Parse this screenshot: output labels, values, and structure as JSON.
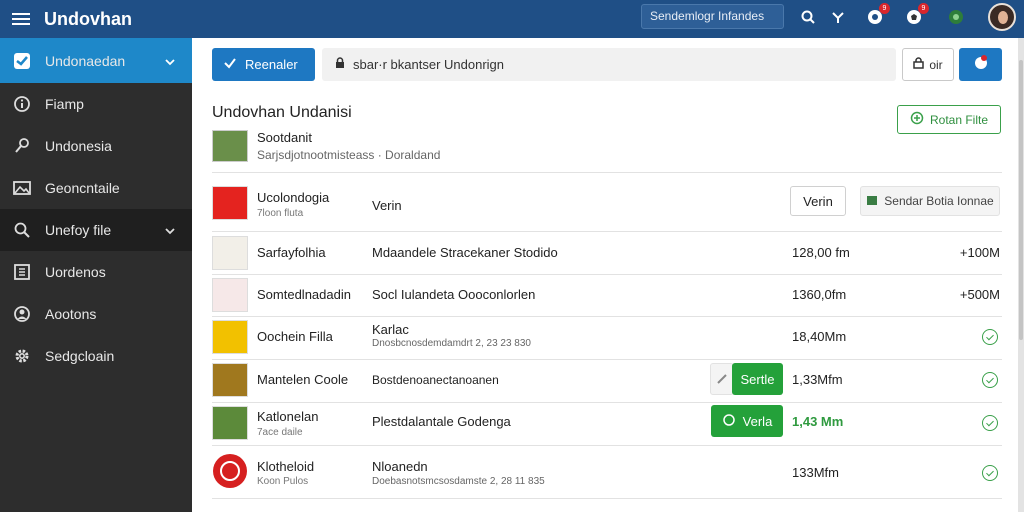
{
  "app": {
    "title": "Undovhan"
  },
  "topbar": {
    "search_text": "Sendemlogr Infandes",
    "icons": [
      "search-icon",
      "share-icon",
      "shield-icon",
      "soccer-ball-icon",
      "globe-icon"
    ],
    "badges": {
      "notifications": "9",
      "alerts": "9"
    }
  },
  "sidebar": {
    "items": [
      {
        "label": "Undonaedan",
        "icon": "check-icon",
        "active": true,
        "chevron": true
      },
      {
        "label": "Fiamp",
        "icon": "info-icon"
      },
      {
        "label": "Undonesia",
        "icon": "pen-icon"
      },
      {
        "label": "Geoncntaile",
        "icon": "image-icon"
      },
      {
        "label": "Unefoy file",
        "icon": "search-icon",
        "chevron": true,
        "highlight": true
      },
      {
        "label": "Uordenos",
        "icon": "grid-icon"
      },
      {
        "label": "Aootons",
        "icon": "user-icon"
      },
      {
        "label": "Sedgcloain",
        "icon": "gear-icon"
      }
    ]
  },
  "main": {
    "primary_button": "Reenaler",
    "search_text": "sbar·r bkantser Undonrign",
    "outline_button": "oir",
    "section_title": "Undovhan Undanisi",
    "return_button": "Rotan Filte",
    "owner": {
      "name": "Sootdanit",
      "meta": "Sarjsdjotnootmisteass · Doraldand"
    },
    "rows": [
      {
        "name": "Ucolondogia",
        "sub": "7loon fluta",
        "desc": "Verin",
        "thumb": "#e4231f",
        "btn_white": "Verin",
        "btn_gray": "Sendar Botia Ionnae"
      },
      {
        "name": "Sarfayfolhia",
        "desc": "Mdaandele Stracekaner Stodido",
        "size": "128,00 fm",
        "right": "+100M",
        "thumb": "#f2efe8"
      },
      {
        "name": "Somtedlnadadin",
        "desc": "Socl Iulandeta Oooconlorlen",
        "size": "1360,0fm",
        "right": "+500M",
        "thumb": "#f6e8e8"
      },
      {
        "name": "Oochein Filla",
        "desc": "Karlac",
        "desc2": "Dnosbcnosdemdamdrt  2, 23 23 830",
        "size": "18,40Mm",
        "thumb": "#f2c100"
      },
      {
        "name": "Mantelen Coole",
        "desc": "Bostdenoanectanoanen",
        "size": "1,33Mfm",
        "thumb": "#a0781e",
        "btn_green": "Sertle"
      },
      {
        "name": "Katlonelan",
        "sub": "7ace daile",
        "desc": "Plestdalantale Godenga",
        "size": "1,43 Mm",
        "size_green": true,
        "thumb": "#5c8a3a",
        "btn_green": "Verla"
      },
      {
        "name": "Klotheloid",
        "sub": "Koon Pulos",
        "desc": "Nloanedn",
        "desc2": "Doebasnotsmcsosdamste  2, 28 11 835",
        "size": "133Mfm",
        "thumb": "#d62020"
      }
    ]
  },
  "colors": {
    "topbar": "#1f4f86",
    "sidebar": "#2d2d2d",
    "active": "#1e88c9",
    "green": "#24a13a"
  }
}
